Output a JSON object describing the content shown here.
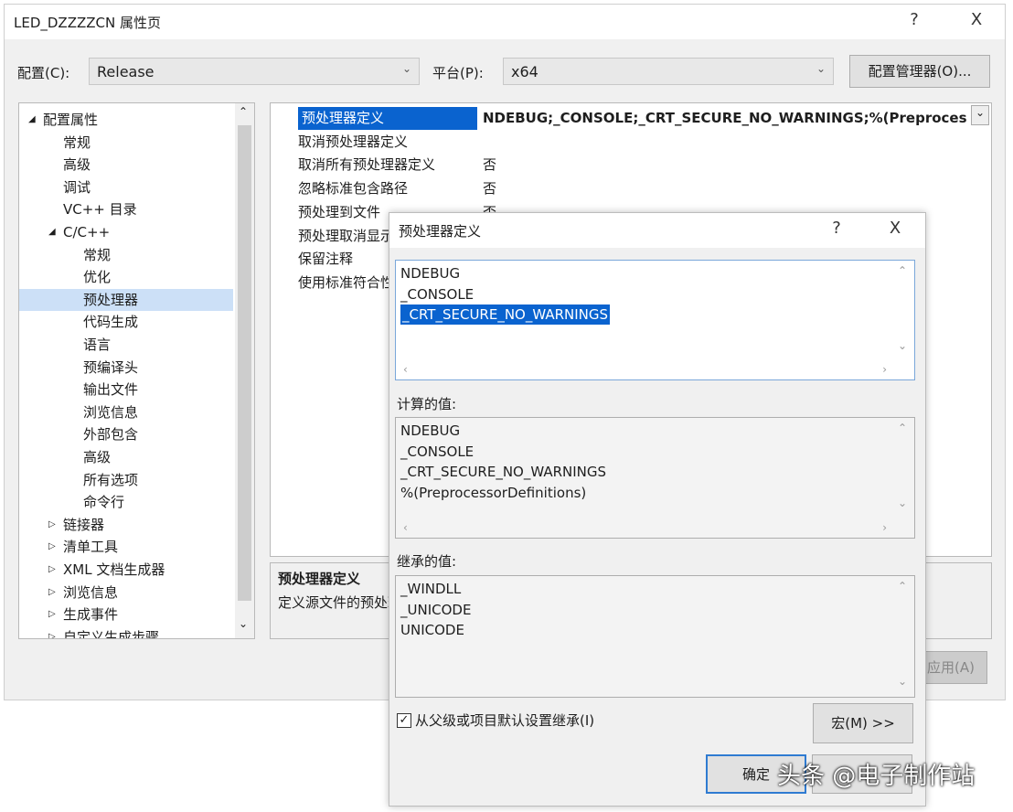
{
  "window": {
    "title": "LED_DZZZZCN 属性页",
    "help": "?",
    "close": "X"
  },
  "config": {
    "label": "配置(C):",
    "value": "Release",
    "platform_label": "平台(P):",
    "platform_value": "x64",
    "manager_button": "配置管理器(O)..."
  },
  "tree": {
    "items": [
      {
        "label": "配置属性",
        "expander": "◢",
        "level": 0
      },
      {
        "label": "常规",
        "level": 1
      },
      {
        "label": "高级",
        "level": 1
      },
      {
        "label": "调试",
        "level": 1
      },
      {
        "label": "VC++ 目录",
        "level": 1
      },
      {
        "label": "C/C++",
        "expander": "◢",
        "level": 1
      },
      {
        "label": "常规",
        "level": 2
      },
      {
        "label": "优化",
        "level": 2
      },
      {
        "label": "预处理器",
        "level": 2,
        "selected": true
      },
      {
        "label": "代码生成",
        "level": 2
      },
      {
        "label": "语言",
        "level": 2
      },
      {
        "label": "预编译头",
        "level": 2
      },
      {
        "label": "输出文件",
        "level": 2
      },
      {
        "label": "浏览信息",
        "level": 2
      },
      {
        "label": "外部包含",
        "level": 2
      },
      {
        "label": "高级",
        "level": 2
      },
      {
        "label": "所有选项",
        "level": 2
      },
      {
        "label": "命令行",
        "level": 2
      },
      {
        "label": "链接器",
        "expander": "▷",
        "level": 1
      },
      {
        "label": "清单工具",
        "expander": "▷",
        "level": 1
      },
      {
        "label": "XML 文档生成器",
        "expander": "▷",
        "level": 1
      },
      {
        "label": "浏览信息",
        "expander": "▷",
        "level": 1
      },
      {
        "label": "生成事件",
        "expander": "▷",
        "level": 1
      },
      {
        "label": "自定义生成步骤",
        "expander": "▷",
        "level": 1
      }
    ]
  },
  "properties": [
    {
      "name": "预处理器定义",
      "value": "NDEBUG;_CONSOLE;_CRT_SECURE_NO_WARNINGS;%(Preprocessor",
      "selected": true
    },
    {
      "name": "取消预处理器定义",
      "value": ""
    },
    {
      "name": "取消所有预处理器定义",
      "value": "否"
    },
    {
      "name": "忽略标准包含路径",
      "value": "否"
    },
    {
      "name": "预处理到文件",
      "value": "否"
    },
    {
      "name": "预处理取消显示行号",
      "value": ""
    },
    {
      "name": "保留注释",
      "value": ""
    },
    {
      "name": "使用标准符合性预处理器",
      "value": ""
    }
  ],
  "description": {
    "title": "预处理器定义",
    "text": "定义源文件的预处理符号。"
  },
  "apply_button": "应用(A)",
  "dialog": {
    "title": "预处理器定义",
    "help": "?",
    "close": "X",
    "edit_lines": [
      "NDEBUG",
      "_CONSOLE",
      "_CRT_SECURE_NO_WARNINGS"
    ],
    "computed_label": "计算的值:",
    "computed_lines": [
      "NDEBUG",
      "_CONSOLE",
      "_CRT_SECURE_NO_WARNINGS",
      "%(PreprocessorDefinitions)"
    ],
    "inherited_label": "继承的值:",
    "inherited_lines": [
      "_WINDLL",
      "_UNICODE",
      "UNICODE"
    ],
    "inherit_checkbox": {
      "label": "从父级或项目默认设置继承(I)",
      "checked": true
    },
    "macro_button": "宏(M) >>",
    "ok_button": "确定"
  },
  "watermark": "头条 @电子制作站",
  "colors": {
    "selection": "#0a63cf",
    "tree_selection": "#cce0f7"
  }
}
